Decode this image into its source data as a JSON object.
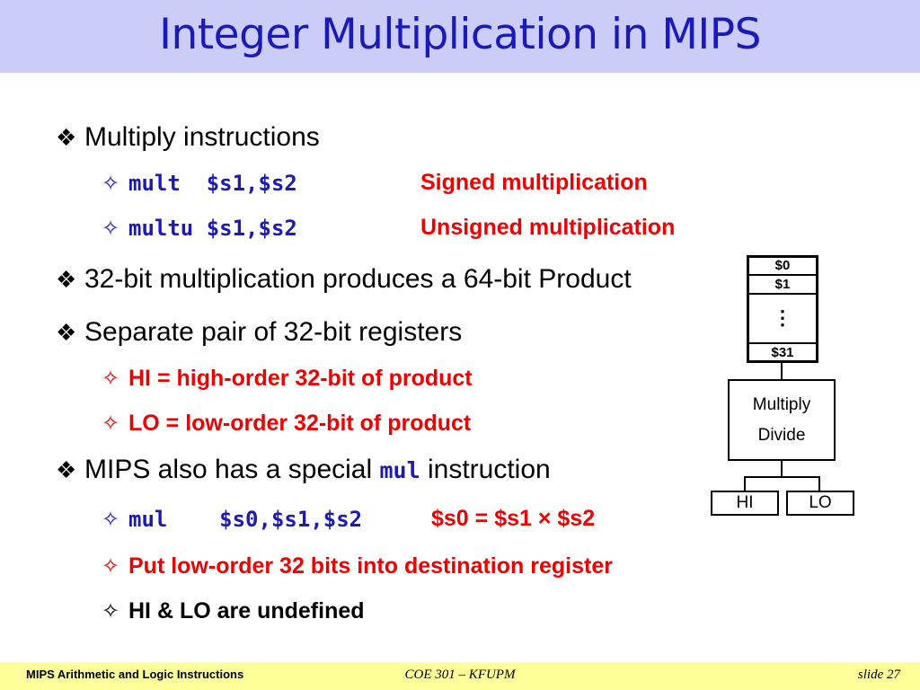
{
  "slide": {
    "title": "Integer Multiplication in MIPS",
    "title_color": "#1a1ab8",
    "title_bg": "#ccccf9",
    "body_bg": "#ffffff",
    "accent_red": "#ee0000",
    "accent_blue": "#1a1ab8",
    "footer_bg": "#ffff99"
  },
  "bullets": {
    "b1": {
      "marker": "❖",
      "text": "Multiply instructions"
    },
    "b1s1": {
      "marker": "✧",
      "code": "mult  $s1,$s2",
      "note": "Signed multiplication"
    },
    "b1s2": {
      "marker": "✧",
      "code": "multu $s1,$s2",
      "note": "Unsigned multiplication"
    },
    "b2": {
      "marker": "❖",
      "text": "32-bit multiplication produces a 64-bit Product"
    },
    "b3": {
      "marker": "❖",
      "text": "Separate pair of 32-bit registers"
    },
    "b3s1": {
      "marker": "✧",
      "text": "HI = high-order 32-bit of product"
    },
    "b3s2": {
      "marker": "✧",
      "text": "LO = low-order 32-bit of product"
    },
    "b4": {
      "marker": "❖",
      "text_before": "MIPS also has a special ",
      "code": "mul",
      "text_after": " instruction"
    },
    "b4s1": {
      "marker": "✧",
      "code": "mul    $s0,$s1,$s2",
      "note": "$s0 = $s1 × $s2"
    },
    "b4s2": {
      "marker": "✧",
      "text": "Put low-order 32 bits into destination register"
    },
    "b4s3": {
      "marker": "✧",
      "text": "HI & LO are undefined"
    }
  },
  "diagram": {
    "registers": {
      "r0": "$0",
      "r1": "$1",
      "dots": "⋮",
      "r31": "$31"
    },
    "unit": {
      "line1": "Multiply",
      "line2": "Divide"
    },
    "hi": "HI",
    "lo": "LO"
  },
  "footer": {
    "left": "MIPS Arithmetic and Logic Instructions",
    "center": "COE 301 – KFUPM",
    "right": "slide 27"
  }
}
